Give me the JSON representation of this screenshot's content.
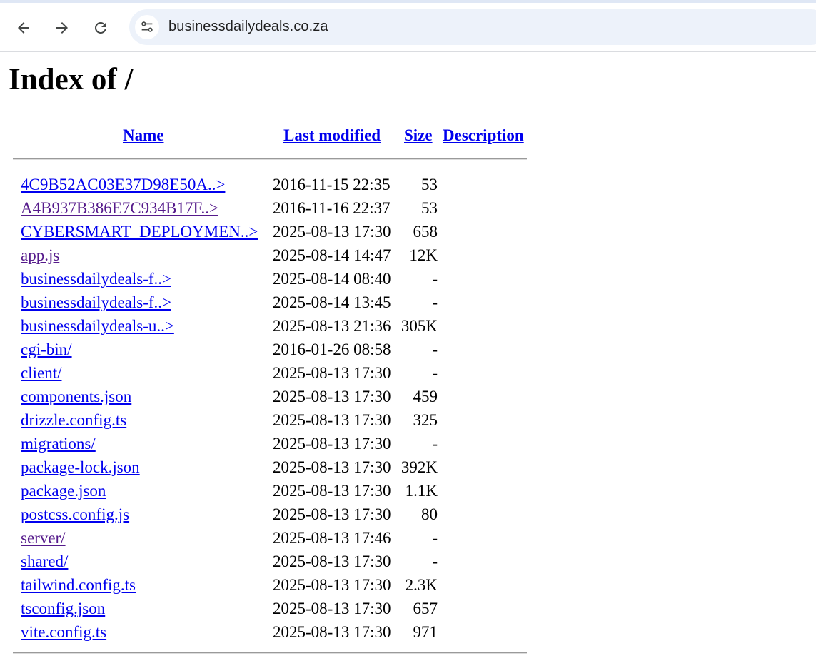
{
  "browser": {
    "url": "businessdailydeals.co.za",
    "icons": {
      "back": "arrow-left-icon",
      "forward": "arrow-right-icon",
      "reload": "reload-icon",
      "site_info": "tune-icon"
    }
  },
  "page": {
    "title": "Index of /",
    "columns": {
      "name": "Name",
      "last_modified": "Last modified",
      "size": "Size",
      "description": "Description"
    },
    "rows": [
      {
        "name": "4C9B52AC03E37D98E50A..>",
        "date": "2016-11-15 22:35",
        "size": "53",
        "visited": false
      },
      {
        "name": "A4B937B386E7C934B17F..>",
        "date": "2016-11-16 22:37",
        "size": "53",
        "visited": true
      },
      {
        "name": "CYBERSMART_DEPLOYMEN..>",
        "date": "2025-08-13 17:30",
        "size": "658",
        "visited": false
      },
      {
        "name": "app.js",
        "date": "2025-08-14 14:47",
        "size": "12K",
        "visited": true
      },
      {
        "name": "businessdailydeals-f..>",
        "date": "2025-08-14 08:40",
        "size": "-",
        "visited": false
      },
      {
        "name": "businessdailydeals-f..>",
        "date": "2025-08-14 13:45",
        "size": "-",
        "visited": false
      },
      {
        "name": "businessdailydeals-u..>",
        "date": "2025-08-13 21:36",
        "size": "305K",
        "visited": false
      },
      {
        "name": "cgi-bin/",
        "date": "2016-01-26 08:58",
        "size": "-",
        "visited": false
      },
      {
        "name": "client/",
        "date": "2025-08-13 17:30",
        "size": "-",
        "visited": false
      },
      {
        "name": "components.json",
        "date": "2025-08-13 17:30",
        "size": "459",
        "visited": false
      },
      {
        "name": "drizzle.config.ts",
        "date": "2025-08-13 17:30",
        "size": "325",
        "visited": false
      },
      {
        "name": "migrations/",
        "date": "2025-08-13 17:30",
        "size": "-",
        "visited": false
      },
      {
        "name": "package-lock.json",
        "date": "2025-08-13 17:30",
        "size": "392K",
        "visited": false
      },
      {
        "name": "package.json",
        "date": "2025-08-13 17:30",
        "size": "1.1K",
        "visited": false
      },
      {
        "name": "postcss.config.js",
        "date": "2025-08-13 17:30",
        "size": "80",
        "visited": false
      },
      {
        "name": "server/",
        "date": "2025-08-13 17:46",
        "size": "-",
        "visited": true
      },
      {
        "name": "shared/",
        "date": "2025-08-13 17:30",
        "size": "-",
        "visited": false
      },
      {
        "name": "tailwind.config.ts",
        "date": "2025-08-13 17:30",
        "size": "2.3K",
        "visited": false
      },
      {
        "name": "tsconfig.json",
        "date": "2025-08-13 17:30",
        "size": "657",
        "visited": false
      },
      {
        "name": "vite.config.ts",
        "date": "2025-08-13 17:30",
        "size": "971",
        "visited": false
      }
    ]
  }
}
